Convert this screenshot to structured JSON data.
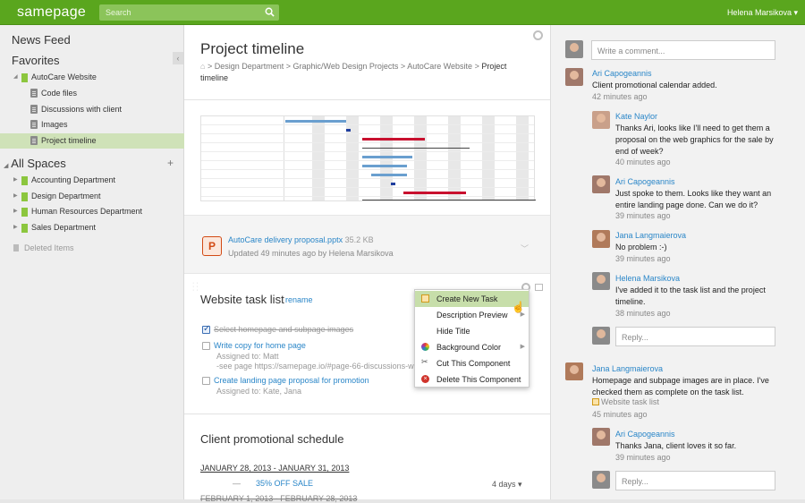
{
  "app": {
    "logo": "samepage",
    "search_placeholder": "Search",
    "user_name": "Helena Marsikova ▾"
  },
  "sidebar": {
    "news_feed": "News Feed",
    "favorites": "Favorites",
    "favorite_items": [
      "AutoCare Website",
      "Code files",
      "Discussions with client",
      "Images",
      "Project timeline"
    ],
    "all_spaces": "All Spaces",
    "spaces": [
      "Accounting Department",
      "Design Department",
      "Human Resources Department",
      "Sales Department"
    ],
    "deleted": "Deleted Items",
    "collapse": "‹",
    "plus": "+"
  },
  "page": {
    "title": "Project timeline",
    "breadcrumb": [
      "Design Department",
      "Graphic/Web Design Projects",
      "AutoCare Website"
    ],
    "breadcrumb_current": "Project timeline",
    "crumb_sep": " > "
  },
  "file": {
    "name": "AutoCare delivery proposal.pptx",
    "size": "35.2 KB",
    "meta": "Updated 49 minutes ago by Helena Marsikova",
    "icon": "P"
  },
  "tasks": {
    "title": "Website task list",
    "rename": "rename",
    "items": [
      {
        "text": "Select homepage and subpage images",
        "done": true,
        "sub": []
      },
      {
        "text": "Write copy for home page",
        "done": false,
        "sub": [
          "Assigned to: Matt",
          "-see page https://samepage.io/#page-66-discussions-w"
        ]
      },
      {
        "text": "Create landing page proposal for promotion",
        "done": false,
        "sub": [
          "Assigned to: Kate, Jana"
        ]
      }
    ]
  },
  "context_menu": [
    {
      "label": "Create New Task",
      "icon": "task-icon",
      "arrow": false
    },
    {
      "label": "Description Preview",
      "icon": "",
      "arrow": true
    },
    {
      "label": "Hide Title",
      "icon": "",
      "arrow": false
    },
    {
      "label": "Background Color",
      "icon": "color-wheel-icon",
      "arrow": true
    },
    {
      "label": "Cut This Component",
      "icon": "scissors-icon",
      "arrow": false
    },
    {
      "label": "Delete This Component",
      "icon": "delete-icon",
      "arrow": false
    }
  ],
  "schedule": {
    "title": "Client promotional schedule",
    "date_range": "JANUARY 28, 2013 - JANUARY 31, 2013",
    "item": "35% OFF SALE",
    "dash": "—",
    "duration": "4 days ▾",
    "next_range": "FEBRUARY 1, 2013 - FEBRUARY 28, 2013"
  },
  "comments": {
    "write_placeholder": "Write a comment...",
    "threads": [
      {
        "name": "Ari Capogeannis",
        "text": [
          "Client promotional calendar added."
        ],
        "time": "42 minutes ago",
        "replies": [
          {
            "name": "Kate Naylor",
            "text": [
              "Thanks Ari, looks like I'll need to get them a",
              "proposal on the web graphics for the sale by",
              "end of week?"
            ],
            "time": "40 minutes ago"
          },
          {
            "name": "Ari Capogeannis",
            "text": [
              "Just spoke to them. Looks like they want an",
              "entire landing page done. Can we do it?"
            ],
            "time": "39 minutes ago"
          },
          {
            "name": "Jana Langmaierova",
            "text": [
              "No problem :-)"
            ],
            "time": "39 minutes ago"
          },
          {
            "name": "Helena Marsikova",
            "text": [
              "I've added it to the task list and the project",
              "timeline."
            ],
            "time": "38 minutes ago"
          }
        ]
      },
      {
        "name": "Jana Langmaierova",
        "text": [
          "Homepage and subpage images are in place. I've",
          "checked them as complete on the task list."
        ],
        "link": "Website task list",
        "time": "45 minutes ago",
        "replies": [
          {
            "name": "Ari Capogeannis",
            "text": [
              "Thanks Jana, client loves it so far."
            ],
            "time": "39 minutes ago"
          }
        ]
      }
    ],
    "reply_placeholder": "Reply..."
  }
}
